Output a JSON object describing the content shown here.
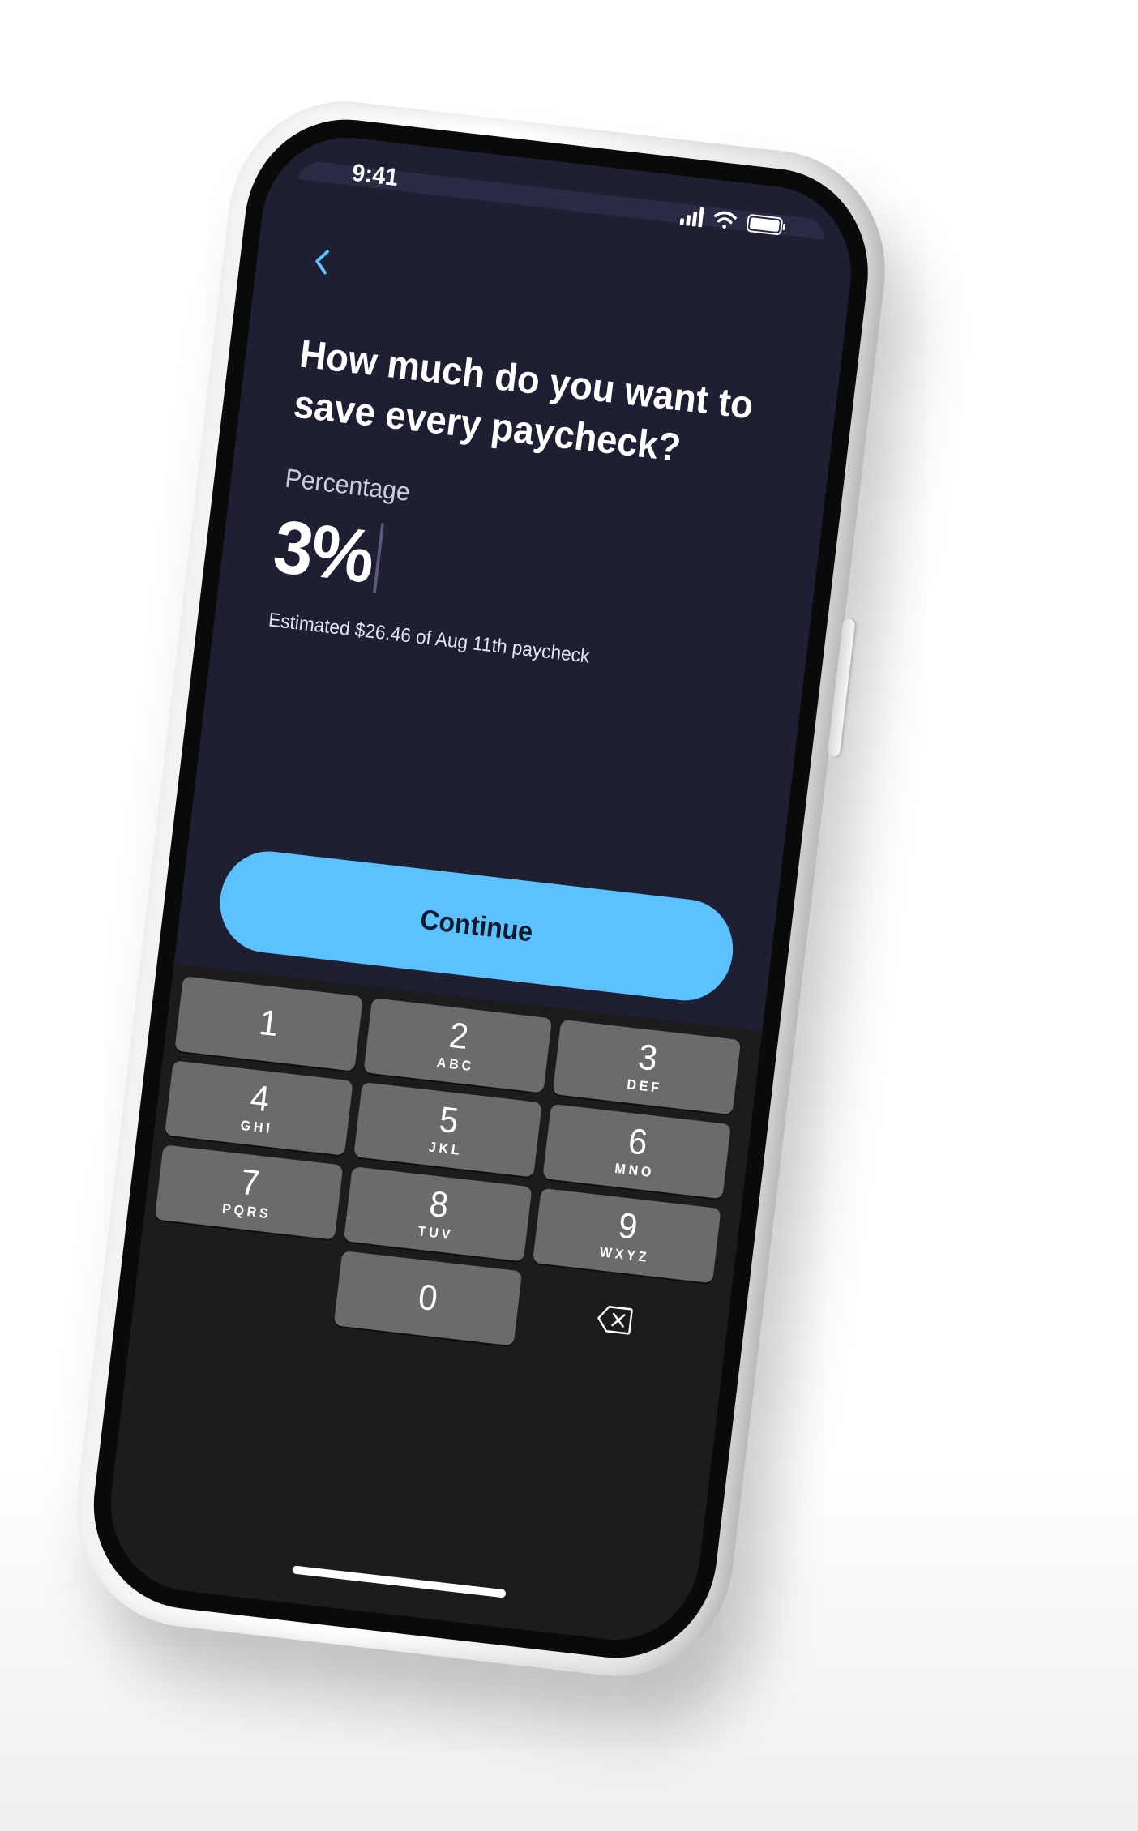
{
  "status_bar": {
    "time": "9:41"
  },
  "header": {
    "back_icon": "chevron-left-icon"
  },
  "question": {
    "title": "How much do you want to save every paycheck?"
  },
  "savings_input": {
    "label": "Percentage",
    "value": "3%",
    "estimate": "Estimated $26.46 of Aug 11th paycheck"
  },
  "actions": {
    "continue_label": "Continue"
  },
  "keypad": {
    "keys": [
      {
        "digit": "1",
        "letters": ""
      },
      {
        "digit": "2",
        "letters": "ABC"
      },
      {
        "digit": "3",
        "letters": "DEF"
      },
      {
        "digit": "4",
        "letters": "GHI"
      },
      {
        "digit": "5",
        "letters": "JKL"
      },
      {
        "digit": "6",
        "letters": "MNO"
      },
      {
        "digit": "7",
        "letters": "PQRS"
      },
      {
        "digit": "8",
        "letters": "TUV"
      },
      {
        "digit": "9",
        "letters": "WXYZ"
      },
      {
        "digit": "0",
        "letters": ""
      }
    ],
    "delete_icon": "backspace-icon"
  },
  "colors": {
    "screen_bg": "#1f1f33",
    "accent": "#5bc2ff",
    "key_bg": "#6b6b6d",
    "keyboard_bg": "#1c1c1e"
  }
}
